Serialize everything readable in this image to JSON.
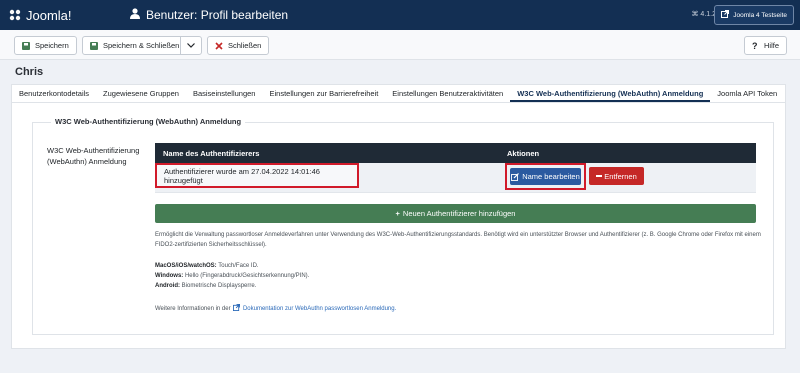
{
  "header": {
    "brand": "Joomla!",
    "title": "Benutzer: Profil bearbeiten",
    "version": "⌘ 4.1.2",
    "site_button": "Joomla 4 Testseite"
  },
  "toolbar": {
    "save": "Speichern",
    "save_close": "Speichern & Schließen",
    "close": "Schließen",
    "help": "Hilfe"
  },
  "page": {
    "user_name": "Chris"
  },
  "tabs": [
    "Benutzerkontodetails",
    "Zugewiesene Gruppen",
    "Basiseinstellungen",
    "Einstellungen zur Barrierefreiheit",
    "Einstellungen Benutzeraktivitäten",
    "W3C Web-Authentifizierung (WebAuthn) Anmeldung",
    "Joomla API Token"
  ],
  "active_tab_index": 5,
  "webauthn": {
    "legend": "W3C Web-Authentifizierung (WebAuthn) Anmeldung",
    "field_label": "W3C Web-Authentifizierung (WebAuthn) Anmeldung",
    "col_name": "Name des Authentifizierers",
    "col_actions": "Aktionen",
    "row_name": "Authentifizierer wurde am 27.04.2022 14:01:46 hinzugefügt",
    "edit_label": "Name bearbeiten",
    "remove_label": "Entfernen",
    "add_label": "Neuen Authentifizierer hinzufügen",
    "description": "Ermöglicht die Verwaltung passwortloser Anmeldeverfahren unter Verwendung des W3C-Web-Authentifizierungsstandards. Benötigt wird ein unterstützter Browser und Authentifizierer (z. B. Google Chrome oder Firefox mit einem FIDO2-zertifizierten Sicherheitsschlüssel).",
    "platforms": [
      {
        "name": "MacOS/iOS/watchOS:",
        "value": "Touch/Face ID."
      },
      {
        "name": "Windows:",
        "value": "Hello (Fingerabdruck/Gesichtserkennung/PIN)."
      },
      {
        "name": "Android:",
        "value": "Biometrische Displaysperre."
      }
    ],
    "more_info_prefix": "Weitere Informationen in der",
    "more_info_link": "Dokumentation zur WebAuthn passwortlosen Anmeldung."
  },
  "colors": {
    "header": "#132f53",
    "success": "#457d54",
    "danger": "#c52827",
    "primary": "#2b5aa0",
    "highlight": "#d11a2a"
  },
  "icons": [
    "joomla-logo-icon",
    "user-icon",
    "external-link-icon",
    "save-icon",
    "close-icon",
    "chevron-down-icon",
    "help-icon",
    "edit-icon",
    "minus-icon",
    "plus-icon"
  ]
}
